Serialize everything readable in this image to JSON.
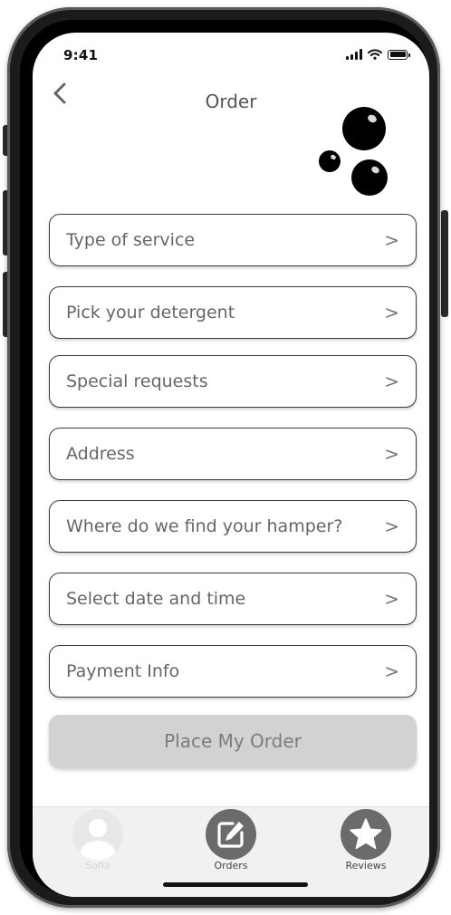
{
  "status_bar": {
    "time": "9:41"
  },
  "header": {
    "title": "Order"
  },
  "menu_items": [
    {
      "label": "Type of service"
    },
    {
      "label": "Pick your detergent"
    },
    {
      "label": "Special requests"
    },
    {
      "label": "Address"
    },
    {
      "label": "Where do we find your hamper?"
    },
    {
      "label": "Select date and time"
    },
    {
      "label": "Payment Info"
    }
  ],
  "place_order": {
    "label": "Place My Order"
  },
  "tabbar": {
    "profile_label": "Sofia",
    "orders_label": "Orders",
    "reviews_label": "Reviews"
  },
  "icons": {
    "back": "chevron-left-icon",
    "chevron": "chevron-right-icon",
    "profile": "user-avatar-icon",
    "orders": "edit-icon",
    "reviews": "star-icon"
  },
  "colors": {
    "button_disabled_bg": "#d2d2d2",
    "tab_icon_bg": "#6b6b6b",
    "text_gray": "#666666"
  }
}
